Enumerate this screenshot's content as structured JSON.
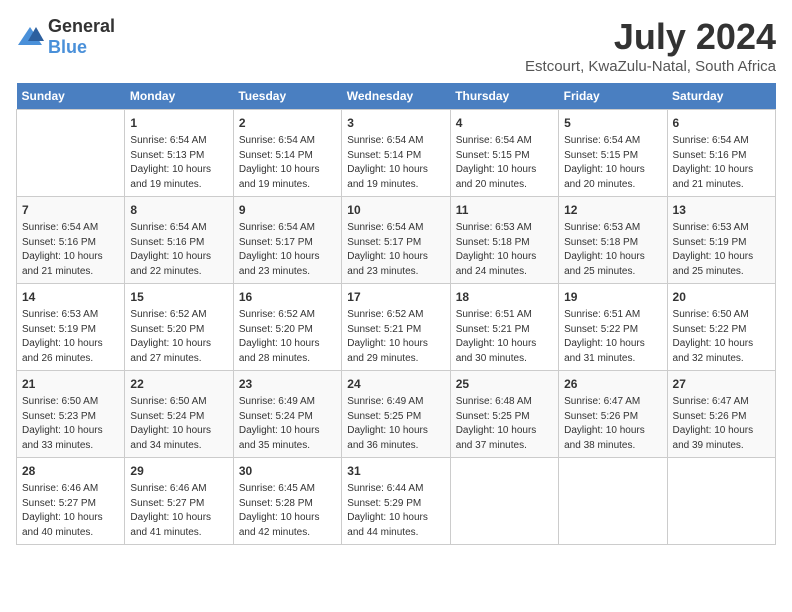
{
  "header": {
    "logo_general": "General",
    "logo_blue": "Blue",
    "title": "July 2024",
    "subtitle": "Estcourt, KwaZulu-Natal, South Africa"
  },
  "calendar": {
    "days_of_week": [
      "Sunday",
      "Monday",
      "Tuesday",
      "Wednesday",
      "Thursday",
      "Friday",
      "Saturday"
    ],
    "weeks": [
      [
        {
          "day": "",
          "info": ""
        },
        {
          "day": "1",
          "info": "Sunrise: 6:54 AM\nSunset: 5:13 PM\nDaylight: 10 hours\nand 19 minutes."
        },
        {
          "day": "2",
          "info": "Sunrise: 6:54 AM\nSunset: 5:14 PM\nDaylight: 10 hours\nand 19 minutes."
        },
        {
          "day": "3",
          "info": "Sunrise: 6:54 AM\nSunset: 5:14 PM\nDaylight: 10 hours\nand 19 minutes."
        },
        {
          "day": "4",
          "info": "Sunrise: 6:54 AM\nSunset: 5:15 PM\nDaylight: 10 hours\nand 20 minutes."
        },
        {
          "day": "5",
          "info": "Sunrise: 6:54 AM\nSunset: 5:15 PM\nDaylight: 10 hours\nand 20 minutes."
        },
        {
          "day": "6",
          "info": "Sunrise: 6:54 AM\nSunset: 5:16 PM\nDaylight: 10 hours\nand 21 minutes."
        }
      ],
      [
        {
          "day": "7",
          "info": "Sunrise: 6:54 AM\nSunset: 5:16 PM\nDaylight: 10 hours\nand 21 minutes."
        },
        {
          "day": "8",
          "info": "Sunrise: 6:54 AM\nSunset: 5:16 PM\nDaylight: 10 hours\nand 22 minutes."
        },
        {
          "day": "9",
          "info": "Sunrise: 6:54 AM\nSunset: 5:17 PM\nDaylight: 10 hours\nand 23 minutes."
        },
        {
          "day": "10",
          "info": "Sunrise: 6:54 AM\nSunset: 5:17 PM\nDaylight: 10 hours\nand 23 minutes."
        },
        {
          "day": "11",
          "info": "Sunrise: 6:53 AM\nSunset: 5:18 PM\nDaylight: 10 hours\nand 24 minutes."
        },
        {
          "day": "12",
          "info": "Sunrise: 6:53 AM\nSunset: 5:18 PM\nDaylight: 10 hours\nand 25 minutes."
        },
        {
          "day": "13",
          "info": "Sunrise: 6:53 AM\nSunset: 5:19 PM\nDaylight: 10 hours\nand 25 minutes."
        }
      ],
      [
        {
          "day": "14",
          "info": "Sunrise: 6:53 AM\nSunset: 5:19 PM\nDaylight: 10 hours\nand 26 minutes."
        },
        {
          "day": "15",
          "info": "Sunrise: 6:52 AM\nSunset: 5:20 PM\nDaylight: 10 hours\nand 27 minutes."
        },
        {
          "day": "16",
          "info": "Sunrise: 6:52 AM\nSunset: 5:20 PM\nDaylight: 10 hours\nand 28 minutes."
        },
        {
          "day": "17",
          "info": "Sunrise: 6:52 AM\nSunset: 5:21 PM\nDaylight: 10 hours\nand 29 minutes."
        },
        {
          "day": "18",
          "info": "Sunrise: 6:51 AM\nSunset: 5:21 PM\nDaylight: 10 hours\nand 30 minutes."
        },
        {
          "day": "19",
          "info": "Sunrise: 6:51 AM\nSunset: 5:22 PM\nDaylight: 10 hours\nand 31 minutes."
        },
        {
          "day": "20",
          "info": "Sunrise: 6:50 AM\nSunset: 5:22 PM\nDaylight: 10 hours\nand 32 minutes."
        }
      ],
      [
        {
          "day": "21",
          "info": "Sunrise: 6:50 AM\nSunset: 5:23 PM\nDaylight: 10 hours\nand 33 minutes."
        },
        {
          "day": "22",
          "info": "Sunrise: 6:50 AM\nSunset: 5:24 PM\nDaylight: 10 hours\nand 34 minutes."
        },
        {
          "day": "23",
          "info": "Sunrise: 6:49 AM\nSunset: 5:24 PM\nDaylight: 10 hours\nand 35 minutes."
        },
        {
          "day": "24",
          "info": "Sunrise: 6:49 AM\nSunset: 5:25 PM\nDaylight: 10 hours\nand 36 minutes."
        },
        {
          "day": "25",
          "info": "Sunrise: 6:48 AM\nSunset: 5:25 PM\nDaylight: 10 hours\nand 37 minutes."
        },
        {
          "day": "26",
          "info": "Sunrise: 6:47 AM\nSunset: 5:26 PM\nDaylight: 10 hours\nand 38 minutes."
        },
        {
          "day": "27",
          "info": "Sunrise: 6:47 AM\nSunset: 5:26 PM\nDaylight: 10 hours\nand 39 minutes."
        }
      ],
      [
        {
          "day": "28",
          "info": "Sunrise: 6:46 AM\nSunset: 5:27 PM\nDaylight: 10 hours\nand 40 minutes."
        },
        {
          "day": "29",
          "info": "Sunrise: 6:46 AM\nSunset: 5:27 PM\nDaylight: 10 hours\nand 41 minutes."
        },
        {
          "day": "30",
          "info": "Sunrise: 6:45 AM\nSunset: 5:28 PM\nDaylight: 10 hours\nand 42 minutes."
        },
        {
          "day": "31",
          "info": "Sunrise: 6:44 AM\nSunset: 5:29 PM\nDaylight: 10 hours\nand 44 minutes."
        },
        {
          "day": "",
          "info": ""
        },
        {
          "day": "",
          "info": ""
        },
        {
          "day": "",
          "info": ""
        }
      ]
    ]
  }
}
